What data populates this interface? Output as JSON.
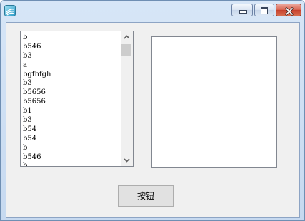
{
  "list": {
    "items": [
      "b",
      "b546",
      "b3",
      "a",
      "bgfhfgh",
      "b3",
      "b5656",
      "b5656",
      "b1",
      "b3",
      "b54",
      "b54",
      "b",
      "b546",
      "b"
    ]
  },
  "textbox": {
    "value": ""
  },
  "button": {
    "label": "按钮"
  },
  "icons": {
    "app": "app-icon",
    "minimize": "minimize-icon",
    "maximize": "maximize-icon",
    "close": "close-icon",
    "scroll_up": "chevron-up-icon",
    "scroll_down": "chevron-down-icon"
  },
  "colors": {
    "client_bg": "#f0f0f0",
    "close_button": "#c6402d",
    "titlebar": "#d7e6f7"
  }
}
